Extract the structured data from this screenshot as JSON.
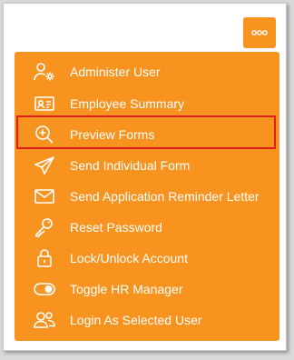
{
  "colors": {
    "accent": "#f7931e",
    "menu_text": "#ffffff",
    "highlight": "#e01e1e"
  },
  "more_button": {
    "icon": "ellipsis-icon"
  },
  "menu": {
    "items": [
      {
        "label": "Administer User",
        "icon": "user-gear-icon"
      },
      {
        "label": "Employee Summary",
        "icon": "id-card-icon"
      },
      {
        "label": "Preview Forms",
        "icon": "zoom-in-icon",
        "highlighted": true
      },
      {
        "label": "Send Individual Form",
        "icon": "paper-plane-icon"
      },
      {
        "label": "Send Application Reminder Letter",
        "icon": "envelope-icon"
      },
      {
        "label": "Reset Password",
        "icon": "key-icon"
      },
      {
        "label": "Lock/Unlock Account",
        "icon": "lock-icon"
      },
      {
        "label": "Toggle HR Manager",
        "icon": "toggle-icon"
      },
      {
        "label": "Login As Selected User",
        "icon": "users-icon"
      }
    ]
  }
}
